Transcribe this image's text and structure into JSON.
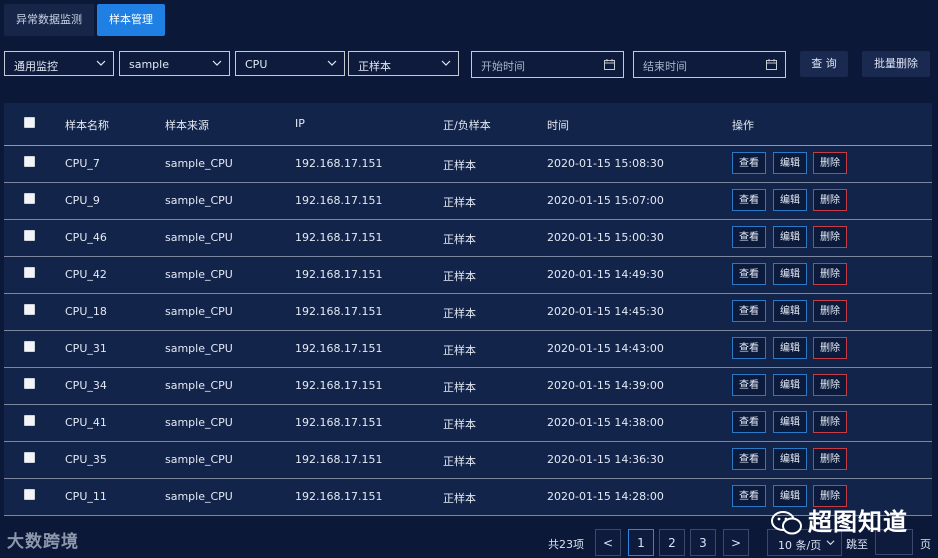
{
  "tabs": [
    {
      "label": "异常数据监测",
      "active": false
    },
    {
      "label": "样本管理",
      "active": true
    }
  ],
  "filters": {
    "select1": "通用监控",
    "select2": "sample",
    "select3": "CPU",
    "select4": "正样本",
    "start_placeholder": "开始时间",
    "end_placeholder": "结束时间",
    "query_label": "查 询",
    "batch_delete_label": "批量删除"
  },
  "table": {
    "headers": [
      "样本名称",
      "样本来源",
      "IP",
      "正/负样本",
      "时间",
      "操作"
    ],
    "rows": [
      {
        "name": "CPU_7",
        "source": "sample_CPU",
        "ip": "192.168.17.151",
        "type": "正样本",
        "time": "2020-01-15 15:08:30"
      },
      {
        "name": "CPU_9",
        "source": "sample_CPU",
        "ip": "192.168.17.151",
        "type": "正样本",
        "time": "2020-01-15 15:07:00"
      },
      {
        "name": "CPU_46",
        "source": "sample_CPU",
        "ip": "192.168.17.151",
        "type": "正样本",
        "time": "2020-01-15 15:00:30"
      },
      {
        "name": "CPU_42",
        "source": "sample_CPU",
        "ip": "192.168.17.151",
        "type": "正样本",
        "time": "2020-01-15 14:49:30"
      },
      {
        "name": "CPU_18",
        "source": "sample_CPU",
        "ip": "192.168.17.151",
        "type": "正样本",
        "time": "2020-01-15 14:45:30"
      },
      {
        "name": "CPU_31",
        "source": "sample_CPU",
        "ip": "192.168.17.151",
        "type": "正样本",
        "time": "2020-01-15 14:43:00"
      },
      {
        "name": "CPU_34",
        "source": "sample_CPU",
        "ip": "192.168.17.151",
        "type": "正样本",
        "time": "2020-01-15 14:39:00"
      },
      {
        "name": "CPU_41",
        "source": "sample_CPU",
        "ip": "192.168.17.151",
        "type": "正样本",
        "time": "2020-01-15 14:38:00"
      },
      {
        "name": "CPU_35",
        "source": "sample_CPU",
        "ip": "192.168.17.151",
        "type": "正样本",
        "time": "2020-01-15 14:36:30"
      },
      {
        "name": "CPU_11",
        "source": "sample_CPU",
        "ip": "192.168.17.151",
        "type": "正样本",
        "time": "2020-01-15 14:28:00"
      }
    ],
    "actions": {
      "view": "查看",
      "edit": "编辑",
      "delete": "删除"
    }
  },
  "pagination": {
    "total": "共23项",
    "pages": [
      "1",
      "2",
      "3"
    ],
    "current_page": "1",
    "prev": "<",
    "next": ">",
    "page_size": "10 条/页",
    "jump_label": "跳至",
    "page_suffix": "页"
  },
  "branding": {
    "logo": "大数跨境",
    "watermark": "超图知道"
  },
  "colors": {
    "background": "#0b1838",
    "table_bg": "#13244a",
    "accent": "#1f7fe3",
    "delete_border": "#c53c44",
    "view_border": "#2b78c4"
  }
}
